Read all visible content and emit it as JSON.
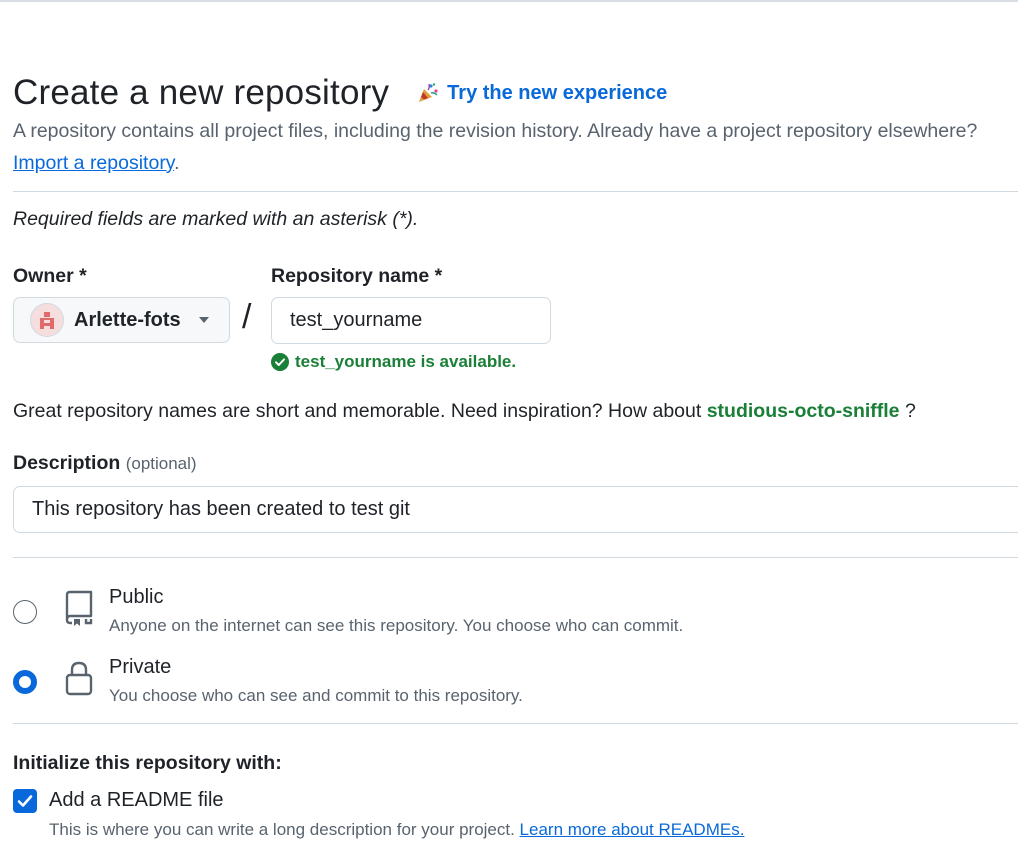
{
  "header": {
    "title": "Create a new repository",
    "try_link_label": "Try the new experience",
    "subtitle": "A repository contains all project files, including the revision history. Already have a project repository elsewhere?",
    "import_link": "Import a repository",
    "import_suffix": "."
  },
  "form": {
    "required_note": "Required fields are marked with an asterisk (*).",
    "owner": {
      "label": "Owner *",
      "value": "Arlette-fots"
    },
    "separator": "/",
    "repo_name": {
      "label": "Repository name *",
      "value": "test_yourname",
      "availability": "test_yourname is available."
    },
    "inspiration": {
      "text": "Great repository names are short and memorable. Need inspiration? How about ",
      "suggestion": "studious-octo-sniffle",
      "suffix": " ?"
    },
    "description": {
      "label": "Description",
      "optional": "(optional)",
      "value": "This repository has been created to test git"
    },
    "visibility": [
      {
        "title": "Public",
        "description": "Anyone on the internet can see this repository. You choose who can commit.",
        "selected": false,
        "icon": "repo-icon"
      },
      {
        "title": "Private",
        "description": "You choose who can see and commit to this repository.",
        "selected": true,
        "icon": "lock-icon"
      }
    ],
    "initialize": {
      "label": "Initialize this repository with:",
      "readme_label": "Add a README file",
      "readme_checked": true,
      "readme_desc": "This is where you can write a long description for your project. ",
      "readme_link": "Learn more about READMEs."
    }
  },
  "colors": {
    "link": "#0969da",
    "success": "#1a7f37",
    "muted": "#59636e",
    "border": "#d1d9e0"
  }
}
